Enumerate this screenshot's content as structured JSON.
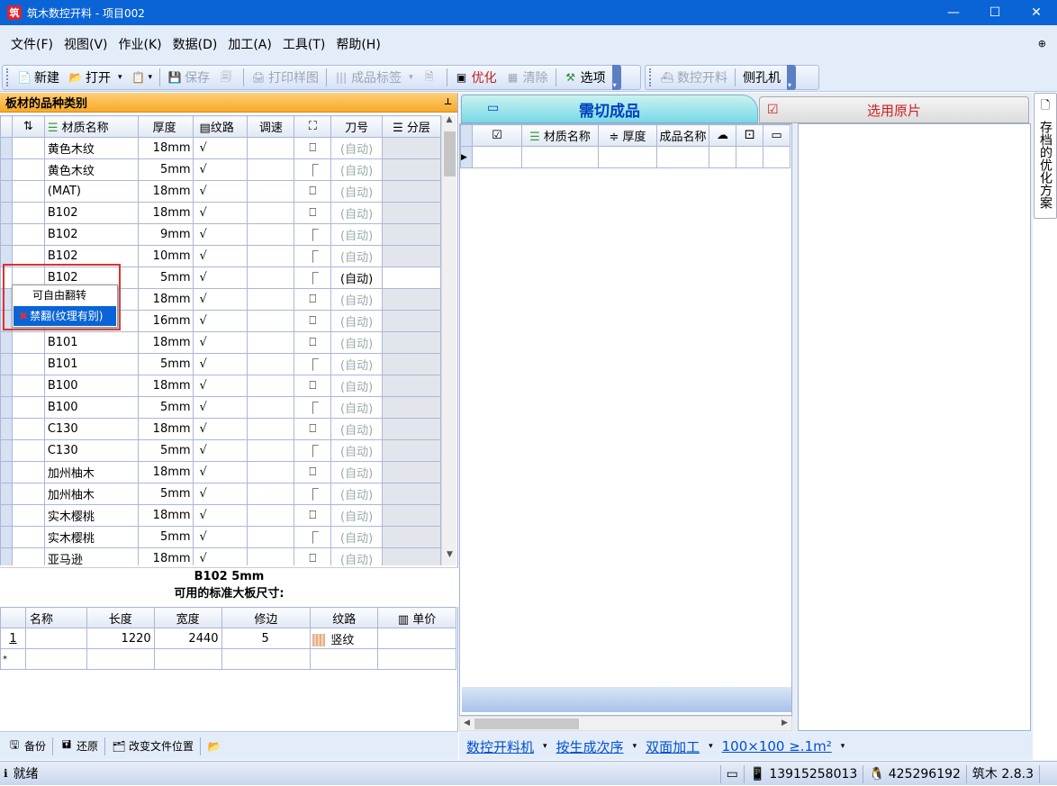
{
  "window": {
    "title": "筑木数控开料 - 项目002",
    "app_icon": "筑"
  },
  "menu": [
    "文件(F)",
    "视图(V)",
    "作业(K)",
    "数据(D)",
    "加工(A)",
    "工具(T)",
    "帮助(H)"
  ],
  "toolbar": {
    "new": "新建",
    "open": "打开",
    "save": "保存",
    "print_sample": "打印样图",
    "product_label": "成品标签",
    "optimize": "优化",
    "clear": "清除",
    "options": "选项",
    "cnc": "数控开料",
    "side_drill": "侧孔机"
  },
  "left_panel": {
    "title": "板材的品种类别",
    "columns": {
      "material": "材质名称",
      "thickness": "厚度",
      "grain": "纹路",
      "adjust": "调速",
      "knife": "刀号",
      "layer": "分层"
    },
    "rows": [
      {
        "material": "黄色木纹",
        "thickness": "18mm",
        "grain": "√",
        "shape": "rect",
        "knife": "(自动)"
      },
      {
        "material": "黄色木纹",
        "thickness": "5mm",
        "grain": "√",
        "shape": "step",
        "knife": "(自动)"
      },
      {
        "material": "(MAT)",
        "thickness": "18mm",
        "grain": "√",
        "shape": "rect",
        "knife": "(自动)"
      },
      {
        "material": "B102",
        "thickness": "18mm",
        "grain": "√",
        "shape": "rect",
        "knife": "(自动)"
      },
      {
        "material": "B102",
        "thickness": "9mm",
        "grain": "√",
        "shape": "step",
        "knife": "(自动)"
      },
      {
        "material": "B102",
        "thickness": "10mm",
        "grain": "√",
        "shape": "step",
        "knife": "(自动)"
      },
      {
        "material": "B102",
        "thickness": "5mm",
        "grain": "√",
        "shape": "step",
        "knife": "(自动)"
      },
      {
        "material": "",
        "thickness": "18mm",
        "grain": "√",
        "shape": "rect",
        "knife": "(自动)"
      },
      {
        "material": "",
        "thickness": "16mm",
        "grain": "√",
        "shape": "rect",
        "knife": "(自动)"
      },
      {
        "material": "B101",
        "thickness": "18mm",
        "grain": "√",
        "shape": "rect",
        "knife": "(自动)"
      },
      {
        "material": "B101",
        "thickness": "5mm",
        "grain": "√",
        "shape": "step",
        "knife": "(自动)"
      },
      {
        "material": "B100",
        "thickness": "18mm",
        "grain": "√",
        "shape": "rect",
        "knife": "(自动)"
      },
      {
        "material": "B100",
        "thickness": "5mm",
        "grain": "√",
        "shape": "step",
        "knife": "(自动)"
      },
      {
        "material": "C130",
        "thickness": "18mm",
        "grain": "√",
        "shape": "rect",
        "knife": "(自动)"
      },
      {
        "material": "C130",
        "thickness": "5mm",
        "grain": "√",
        "shape": "step",
        "knife": "(自动)"
      },
      {
        "material": "加州柚木",
        "thickness": "18mm",
        "grain": "√",
        "shape": "rect",
        "knife": "(自动)"
      },
      {
        "material": "加州柚木",
        "thickness": "5mm",
        "grain": "√",
        "shape": "step",
        "knife": "(自动)"
      },
      {
        "material": "实木樱桃",
        "thickness": "18mm",
        "grain": "√",
        "shape": "rect",
        "knife": "(自动)"
      },
      {
        "material": "实木樱桃",
        "thickness": "5mm",
        "grain": "√",
        "shape": "step",
        "knife": "(自动)"
      },
      {
        "material": "亚马逊",
        "thickness": "18mm",
        "grain": "√",
        "shape": "rect",
        "knife": "(自动)"
      }
    ],
    "selected_row_marker": "▸",
    "popup": {
      "option1": "可自由翻转",
      "option2": "禁翻(纹理有别)"
    }
  },
  "board_info": {
    "heading": "B102 5mm",
    "subheading": "可用的标准大板尺寸:",
    "columns": {
      "name": "名称",
      "length": "长度",
      "width": "宽度",
      "trim": "修边",
      "grain": "纹路",
      "price": "单价"
    },
    "rows": [
      {
        "index": "1",
        "name": "",
        "length": "1220",
        "width": "2440",
        "trim": "5",
        "grain": "竖纹",
        "price": ""
      }
    ],
    "new_row_marker": "*"
  },
  "left_bottom": {
    "backup": "备份",
    "restore": "还原",
    "change_location": "改变文件位置"
  },
  "right_panel": {
    "tab_active": "需切成品",
    "tab_inactive": "选用原片",
    "columns": {
      "material": "材质名称",
      "thickness": "厚度",
      "product_name": "成品名称"
    }
  },
  "right_bottom": {
    "cnc": "数控开料机",
    "order": "按生成次序",
    "double_side": "双面加工",
    "size": "100×100 ≥.1m²"
  },
  "side_tab": "存档的优化方案",
  "status": {
    "ready": "就绪",
    "phone": "13915258013",
    "qq": "425296192",
    "version": "筑木 2.8.3"
  }
}
